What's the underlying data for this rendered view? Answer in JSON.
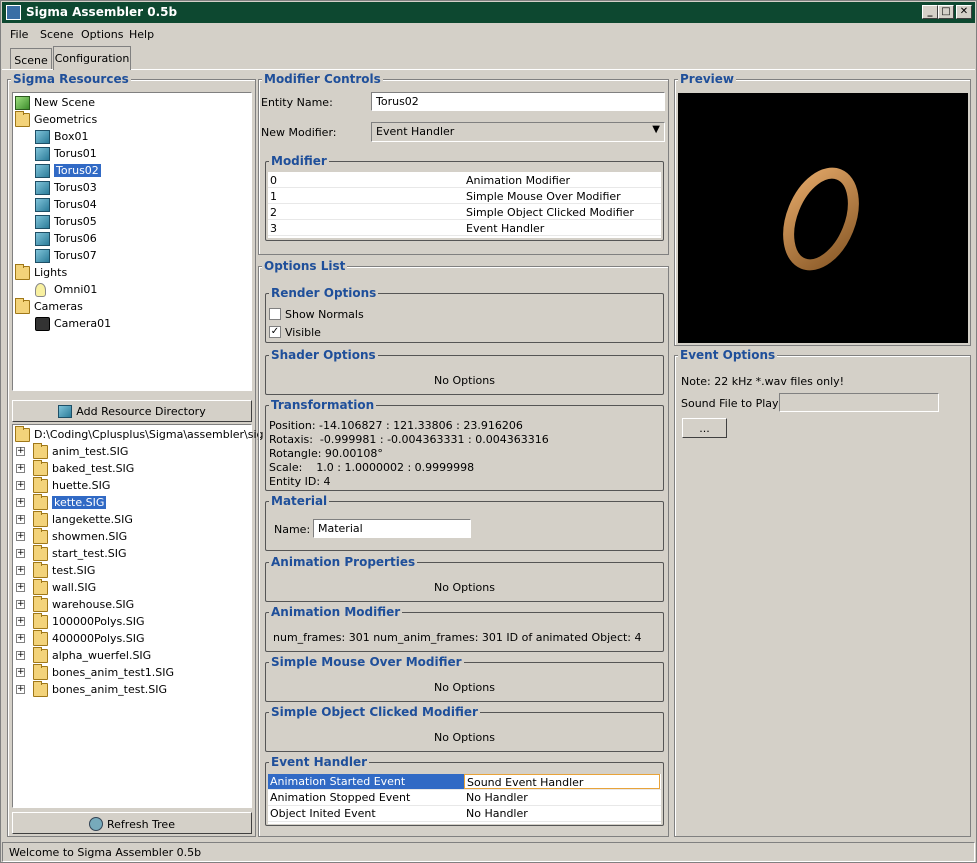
{
  "window": {
    "title": "Sigma Assembler 0.5b",
    "min": "_",
    "max": "□",
    "close": "✕"
  },
  "menu": [
    "File",
    "Scene",
    "Options",
    "Help"
  ],
  "tabs": [
    "Scene",
    "Configuration"
  ],
  "resources": {
    "title": "Sigma Resources",
    "tree": [
      {
        "label": "New Scene",
        "icon": "scene-icon",
        "level": 0
      },
      {
        "label": "Geometrics",
        "icon": "folder-icon",
        "level": 0
      },
      {
        "label": "Box01",
        "icon": "cube-icon",
        "level": 1
      },
      {
        "label": "Torus01",
        "icon": "cube-icon",
        "level": 1
      },
      {
        "label": "Torus02",
        "icon": "cube-icon",
        "level": 1,
        "selected": true
      },
      {
        "label": "Torus03",
        "icon": "cube-icon",
        "level": 1
      },
      {
        "label": "Torus04",
        "icon": "cube-icon",
        "level": 1
      },
      {
        "label": "Torus05",
        "icon": "cube-icon",
        "level": 1
      },
      {
        "label": "Torus06",
        "icon": "cube-icon",
        "level": 1
      },
      {
        "label": "Torus07",
        "icon": "cube-icon",
        "level": 1
      },
      {
        "label": "Lights",
        "icon": "folder-icon",
        "level": 0
      },
      {
        "label": "Omni01",
        "icon": "bulb-icon",
        "level": 1
      },
      {
        "label": "Cameras",
        "icon": "folder-icon",
        "level": 0
      },
      {
        "label": "Camera01",
        "icon": "camera-icon",
        "level": 1
      }
    ],
    "add_dir_label": "Add Resource Directory",
    "dir_path": "D:\\Coding\\Cplusplus\\Sigma\\assembler\\sig",
    "files": [
      "anim_test.SIG",
      "baked_test.SIG",
      "huette.SIG",
      "kette.SIG",
      "langekette.SIG",
      "showmen.SIG",
      "start_test.SIG",
      "test.SIG",
      "wall.SIG",
      "warehouse.SIG",
      "100000Polys.SIG",
      "400000Polys.SIG",
      "alpha_wuerfel.SIG",
      "bones_anim_test1.SIG",
      "bones_anim_test.SIG"
    ],
    "selected_file_index": 3,
    "refresh_label": "Refresh Tree"
  },
  "modifier_controls": {
    "title": "Modifier Controls",
    "entity_name_label": "Entity Name:",
    "entity_name": "Torus02",
    "new_modifier_label": "New Modifier:",
    "new_modifier": "Event Handler",
    "modifier_group": "Modifier",
    "modifiers": [
      {
        "id": "0",
        "name": "Animation Modifier"
      },
      {
        "id": "1",
        "name": "Simple Mouse Over Modifier"
      },
      {
        "id": "2",
        "name": "Simple Object Clicked Modifier"
      },
      {
        "id": "3",
        "name": "Event Handler"
      }
    ]
  },
  "options": {
    "title": "Options List",
    "render": {
      "title": "Render Options",
      "show_normals": "Show Normals",
      "show_normals_checked": false,
      "visible": "Visible",
      "visible_checked": true
    },
    "shader": {
      "title": "Shader Options",
      "text": "No Options"
    },
    "transform": {
      "title": "Transformation",
      "lines": [
        "Position: -14.106827 : 121.33806 : 23.916206",
        "Rotaxis:  -0.999981 : -0.004363331 : 0.004363316",
        "Rotangle: 90.00108°",
        "Scale:    1.0 : 1.0000002 : 0.9999998",
        "Entity ID: 4"
      ]
    },
    "material": {
      "title": "Material",
      "name_label": "Name:",
      "name": "Material"
    },
    "anim_props": {
      "title": "Animation Properties",
      "text": "No Options"
    },
    "anim_mod": {
      "title": "Animation Modifier",
      "text": "num_frames: 301 num_anim_frames: 301 ID of animated Object: 4"
    },
    "mouse_over": {
      "title": "Simple Mouse Over Modifier",
      "text": "No Options"
    },
    "clicked": {
      "title": "Simple Object Clicked Modifier",
      "text": "No Options"
    },
    "event_handler": {
      "title": "Event Handler",
      "rows": [
        {
          "event": "Animation Started Event",
          "handler": "Sound Event Handler"
        },
        {
          "event": "Animation Stopped Event",
          "handler": "No Handler"
        },
        {
          "event": "Object Inited Event",
          "handler": "No Handler"
        }
      ]
    }
  },
  "preview": {
    "title": "Preview",
    "ring_color": "#c98c4a"
  },
  "event_options": {
    "title": "Event Options",
    "note": "Note: 22 kHz *.wav files only!",
    "sound_label": "Sound File to Play:",
    "sound_value": "",
    "browse_label": "..."
  },
  "status": "Welcome to Sigma Assembler 0.5b"
}
